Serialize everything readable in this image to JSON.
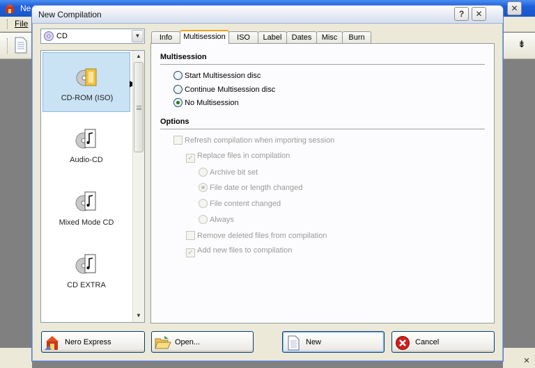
{
  "background": {
    "title": "Ne",
    "menu_file": "File"
  },
  "dialog": {
    "title": "New Compilation",
    "help_label": "?",
    "close_label": "✕"
  },
  "disc_type": {
    "selected": "CD"
  },
  "compilation_types": [
    {
      "label": "CD-ROM (ISO)",
      "selected": true
    },
    {
      "label": "Audio-CD",
      "selected": false
    },
    {
      "label": "Mixed Mode CD",
      "selected": false
    },
    {
      "label": "CD EXTRA",
      "selected": false
    }
  ],
  "tabs": [
    {
      "label": "Info",
      "active": false
    },
    {
      "label": "Multisession",
      "active": true
    },
    {
      "label": "ISO",
      "active": false
    },
    {
      "label": "Label",
      "active": false
    },
    {
      "label": "Dates",
      "active": false
    },
    {
      "label": "Misc",
      "active": false
    },
    {
      "label": "Burn",
      "active": false
    }
  ],
  "multisession": {
    "heading": "Multisession",
    "options": [
      {
        "label": "Start Multisession disc",
        "checked": false
      },
      {
        "label": "Continue Multisession disc",
        "checked": false
      },
      {
        "label": "No Multisession",
        "checked": true
      }
    ]
  },
  "options": {
    "heading": "Options",
    "refresh": "Refresh compilation when importing session",
    "replace": "Replace files in compilation",
    "archive_bit": "Archive bit set",
    "file_date": "File date or length changed",
    "file_content": "File content changed",
    "always": "Always",
    "remove_deleted": "Remove deleted files from compilation",
    "add_new": "Add new files to compilation"
  },
  "footer": {
    "nero_express": "Nero Express",
    "open": "Open...",
    "new": "New",
    "cancel": "Cancel"
  },
  "colors": {
    "tab_accent": "#f5a11b",
    "selection": "#c9e2f4",
    "cancel_red": "#d0201c"
  }
}
